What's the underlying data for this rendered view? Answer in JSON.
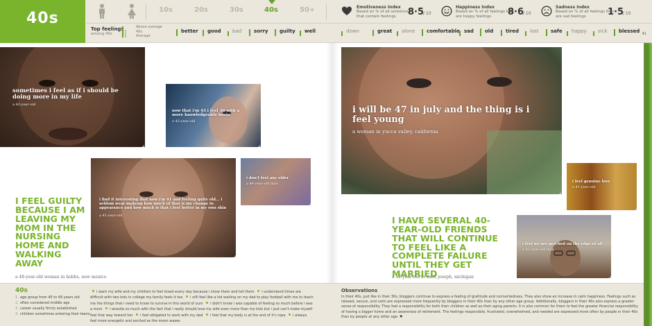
{
  "header": {
    "decade_title": "40s",
    "ages": [
      "10s",
      "20s",
      "30s",
      "40s",
      "50+"
    ],
    "active_age": "40s",
    "indexes": [
      {
        "name": "Emotiveness Index",
        "desc": "Based on % of all sentences that contain feelings",
        "value": "8·5",
        "denom": "/ 10",
        "icon": "heart-icon"
      },
      {
        "name": "Happiness Index",
        "desc": "Based on % of all feelings that are happy feelings",
        "value": "8·6",
        "denom": "/ 10",
        "icon": "smiley-icon"
      },
      {
        "name": "Sadness Index",
        "desc": "Based on % of all feelings that are sad feelings",
        "value": "1·5",
        "denom": "/ 10",
        "icon": "sad-face-icon"
      }
    ],
    "top_feelings_title": "Top feelings",
    "top_feelings_sub": "among 40s",
    "legend": {
      "above": "Above average",
      "age": "40s",
      "average": "Average"
    },
    "feelings": [
      {
        "word": "better",
        "above": true,
        "level": 0.85
      },
      {
        "word": "good",
        "above": true,
        "level": 0.75
      },
      {
        "word": "bad",
        "above": false,
        "level": 0.55
      },
      {
        "word": "sorry",
        "above": true,
        "level": 0.8
      },
      {
        "word": "guilty",
        "above": true,
        "level": 0.85
      },
      {
        "word": "well",
        "above": true,
        "level": 0.7
      },
      {
        "word": "down",
        "above": false,
        "level": 0.6
      },
      {
        "word": "great",
        "above": true,
        "level": 0.75
      },
      {
        "word": "alone",
        "above": false,
        "level": 0.55
      },
      {
        "word": "comfortable",
        "above": true,
        "level": 0.8
      },
      {
        "word": "sad",
        "above": true,
        "level": 0.7
      },
      {
        "word": "old",
        "above": true,
        "level": 0.9
      },
      {
        "word": "tired",
        "above": true,
        "level": 0.75
      },
      {
        "word": "lost",
        "above": false,
        "level": 0.55
      },
      {
        "word": "safe",
        "above": true,
        "level": 0.8
      },
      {
        "word": "happy",
        "above": false,
        "level": 0.6
      },
      {
        "word": "sick",
        "above": false,
        "level": 0.55
      },
      {
        "word": "blessed",
        "above": true,
        "level": 0.85
      }
    ],
    "page_number": "41"
  },
  "photos": [
    {
      "quote": "sometimes i feel as if i should be doing more in my life",
      "who": "a 42-year-old"
    },
    {
      "quote": "now that i'm 43 i feel 30 with a more knowledgeable brain",
      "who": "a 42-year-old"
    },
    {
      "quote": "i find it interesting that now i'm 41 and feeling quite old... i seldom wear makeup how much of that is my change in appearance and how much is that i feel better in my own skin",
      "who": "a 41-year-old"
    },
    {
      "quote": "i don't feel any older",
      "who": "a 44-year-old man"
    },
    {
      "quote": "i will be 47 in july and the thing is i feel young",
      "who": "a woman in yucca valley, california"
    },
    {
      "quote": "i feel genuine love",
      "who": "a 41-year-old"
    },
    {
      "quote": "i feel we are perched on the edge of all",
      "who": "a 42-year-old man"
    }
  ],
  "big_quotes": [
    {
      "text": "I FEEL GUILTY BECAUSE I AM LEAVING MY MOM IN THE NURSING HOME AND WALKING AWAY",
      "who": "a 48-year-old woman in hobbs, new mexico"
    },
    {
      "text": "I HAVE SEVERAL 40-YEAR-OLD FRIENDS THAT WILL CONTINUE TO FEEL LIKE A COMPLETE FAILURE UNTIL THEY GET MARRIED",
      "who": "a 42-year-old in saint joseph, michigan"
    }
  ],
  "footer": {
    "title": "40s",
    "facts": [
      "age group from 40 to 49 years old",
      "often considered middle age",
      "career usually firmly established",
      "children sometimes entering their teens"
    ],
    "snippets": [
      "i want my wife and my children to feel loved every day because i show them and tell them",
      "i understand times are difficult with two kids in college my family feels it too",
      "i still feel like a kid waiting on my dad to play football with me to teach me the things that i need to know to survive in this world of ours",
      "i didn't know i was capable of feeling so much before i was a mom",
      "i wrestle so much with the fact that i really should love my wife even more than my kids but i just can't make myself feel that way toward her",
      "i feel obligated to work with my dad",
      "i feel that my body is at the end of it's rope",
      "i always feel more energetic and excited as the moon waxes"
    ],
    "observations_title": "Observations",
    "observations": "In their 40s, just like in their 30s, bloggers continue to express a feeling of gratitude and connectedness. They also show an increase in calm happiness. Feelings such as relaxed, secure, and calm are expressed more frequently by bloggers in their 40s than by any other age group. Additionally, bloggers in their 40s also express a greater sense of responsibility. They feel a responsibility for both their children as well as their aging parents. It is also common for them to feel the greater financial responsibility of having a bigger home and an awareness of retirement. The feelings responsible, frustrated, overwhelmed, and needed are expressed more often by people in their 40s than by people at any other age. ♥"
  },
  "colors": {
    "accent": "#7ab42c",
    "accent_dark": "#6aa129",
    "band": "#ebe7dc"
  }
}
